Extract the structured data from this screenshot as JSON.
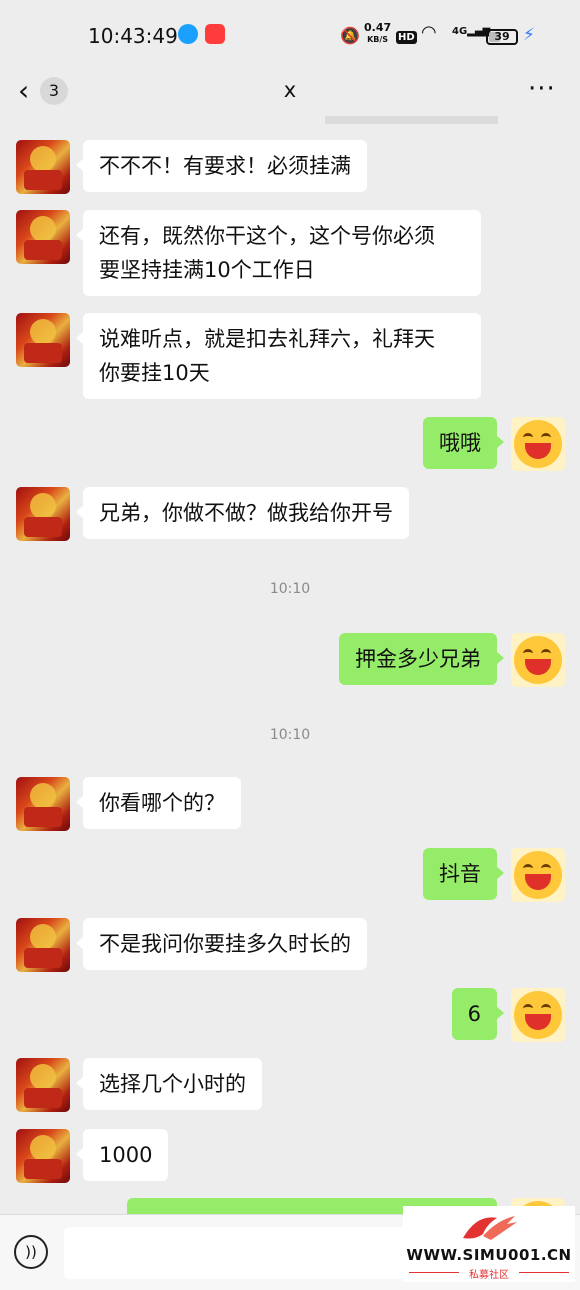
{
  "status_bar": {
    "time": "10:43:49",
    "net_speed_value": "0.47",
    "net_speed_unit": "KB/S",
    "hd": "HD",
    "signal": "4G",
    "battery": "39",
    "battery_level": 0.39
  },
  "header": {
    "unread_count": "3",
    "title": "x",
    "more": "···"
  },
  "messages": [
    {
      "from": "other",
      "text": "不不不！有要求！必须挂满"
    },
    {
      "from": "other",
      "text": "还有，既然你干这个，这个号你必须\n要坚持挂满10个工作日"
    },
    {
      "from": "other",
      "text": "说难听点，就是扣去礼拜六，礼拜天\n你要挂10天"
    },
    {
      "from": "self",
      "text": "哦哦"
    },
    {
      "from": "other",
      "text": "兄弟，你做不做？做我给你开号"
    },
    {
      "timestamp": "10:10"
    },
    {
      "from": "self",
      "text": "押金多少兄弟"
    },
    {
      "timestamp": "10:10"
    },
    {
      "from": "other",
      "text": "你看哪个的？"
    },
    {
      "from": "self",
      "text": "抖音"
    },
    {
      "from": "other",
      "text": "不是我问你要挂多久时长的"
    },
    {
      "from": "self",
      "text": "6"
    },
    {
      "from": "other",
      "text": "选择几个小时的"
    },
    {
      "from": "other",
      "text": "1000"
    }
  ],
  "watermark": {
    "url": "WWW.SIMU001.CN",
    "subtitle": "私募社区"
  }
}
